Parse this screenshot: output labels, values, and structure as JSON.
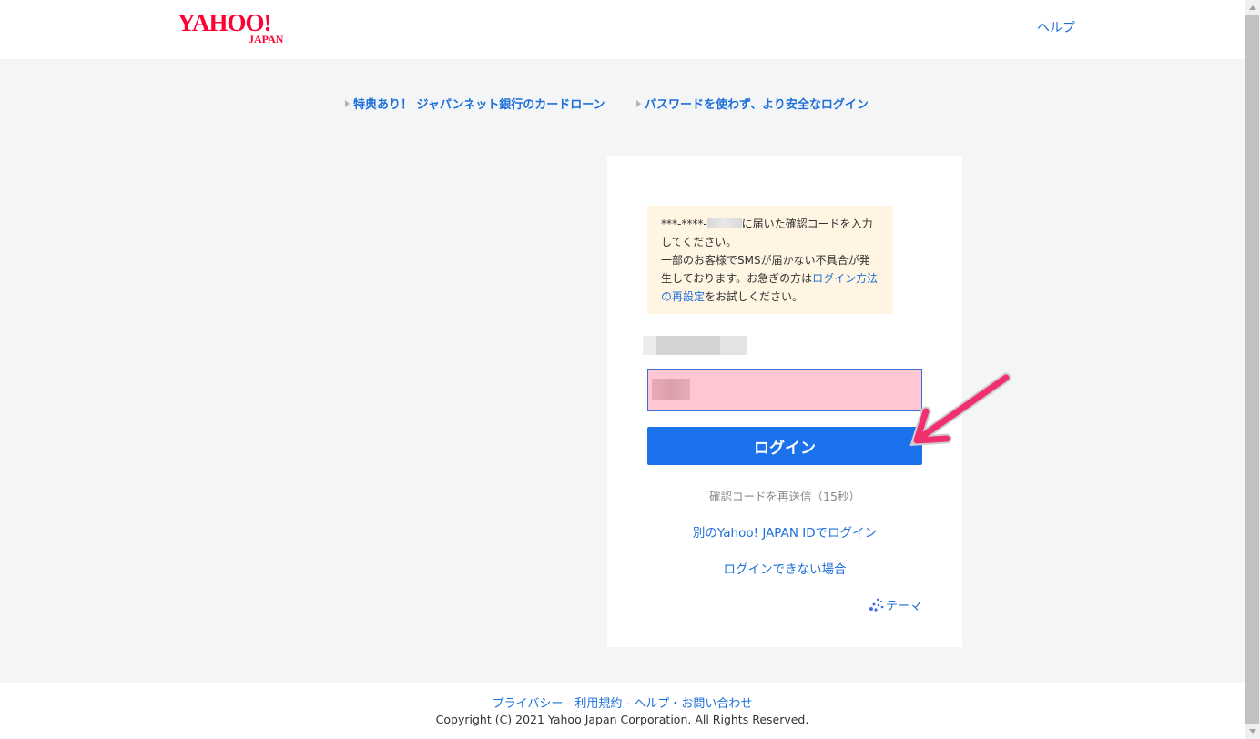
{
  "header": {
    "logo_text_main": "YAHOO!",
    "logo_text_sub": "JAPAN",
    "help_label": "ヘルプ"
  },
  "promos": [
    {
      "label": "特典あり！ ジャパンネット銀行のカードローン"
    },
    {
      "label": "パスワードを使わず、より安全なログイン"
    }
  ],
  "notice": {
    "phone_prefix": "***-****-",
    "text_after_phone": "に届いた確認コードを入力してください。",
    "text_line2": "一部のお客様でSMSが届かない不具合が発生しております。お急ぎの方は",
    "link_label": "ログイン方法の再設定",
    "text_end": "をお試しください。"
  },
  "form": {
    "login_button_label": "ログイン",
    "resend_label": "確認コードを再送信（15秒）",
    "other_id_link": "別のYahoo! JAPAN IDでログイン",
    "cannot_login_link": "ログインできない場合",
    "theme_label": "テーマ"
  },
  "footer": {
    "privacy": "プライバシー",
    "terms": "利用規約",
    "help_contact": "ヘルプ・お問い合わせ",
    "separator": " - ",
    "copyright": "Copyright (C) 2021 Yahoo Japan Corporation. All Rights Reserved."
  },
  "colors": {
    "brand_red": "#ff0033",
    "link_blue": "#1d6fd9",
    "button_blue": "#1c72ec",
    "notice_bg": "#fff5e2",
    "input_highlight": "#ffc7d1",
    "annotation_arrow": "#f0306e"
  }
}
